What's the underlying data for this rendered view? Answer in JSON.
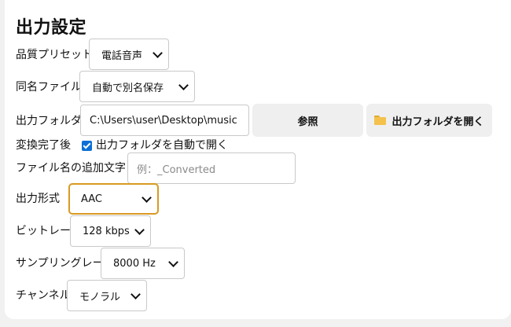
{
  "title": "出力設定",
  "quality_preset": {
    "label": "品質プリセット",
    "value": "電話音声"
  },
  "same_name_file": {
    "label": "同名ファイル",
    "value": "自動で別名保存"
  },
  "output_folder": {
    "label": "出力フォルダ",
    "value": "C:\\Users\\user\\Desktop\\music",
    "browse_label": "参照",
    "open_label": "出力フォルダを開く",
    "open_icon": "folder-icon"
  },
  "after_conversion": {
    "label": "変換完了後",
    "checked": true,
    "checkbox_label": "出力フォルダを自動で開く"
  },
  "filename_suffix": {
    "label": "ファイル名の追加文字",
    "placeholder": "例：_Converted"
  },
  "output_format": {
    "label": "出力形式",
    "value": "AAC"
  },
  "bitrate": {
    "label": "ビットレート",
    "value": "128 kbps"
  },
  "sampling_rate": {
    "label": "サンプリングレート",
    "value": "8000 Hz"
  },
  "channel": {
    "label": "チャンネル",
    "value": "モノラル"
  },
  "colors": {
    "focus_border": "#d99a22",
    "checkbox": "#0b6fd6",
    "folder_icon": "#f4c24c"
  }
}
